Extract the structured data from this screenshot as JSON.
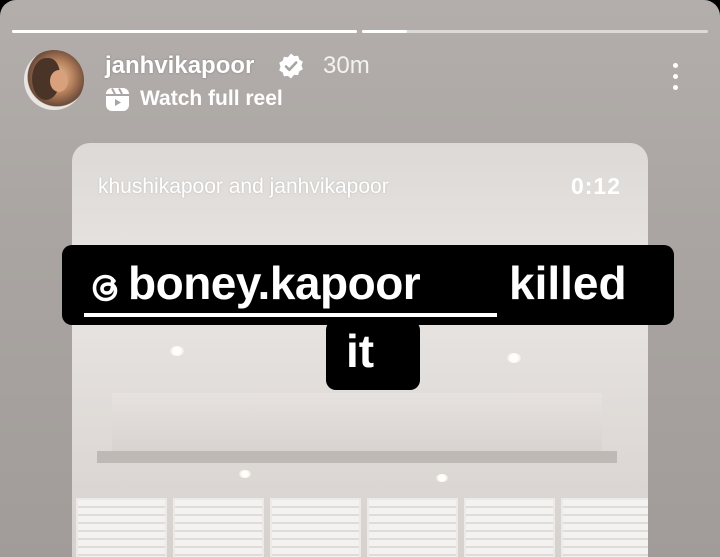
{
  "story": {
    "progress": [
      1.0,
      0.13
    ]
  },
  "header": {
    "username": "janhvikapoor",
    "time": "30m",
    "reel_link": "Watch full reel"
  },
  "reel": {
    "collaborators": "khushikapoor and janhvikapoor",
    "duration": "0:12"
  },
  "caption": {
    "mention": "boney.kapoor",
    "rest": "killed",
    "last": "it"
  },
  "icons": {
    "verified": "verified-badge-icon",
    "reel": "reel-icon",
    "more": "more-dots-icon",
    "threads": "threads-icon"
  }
}
